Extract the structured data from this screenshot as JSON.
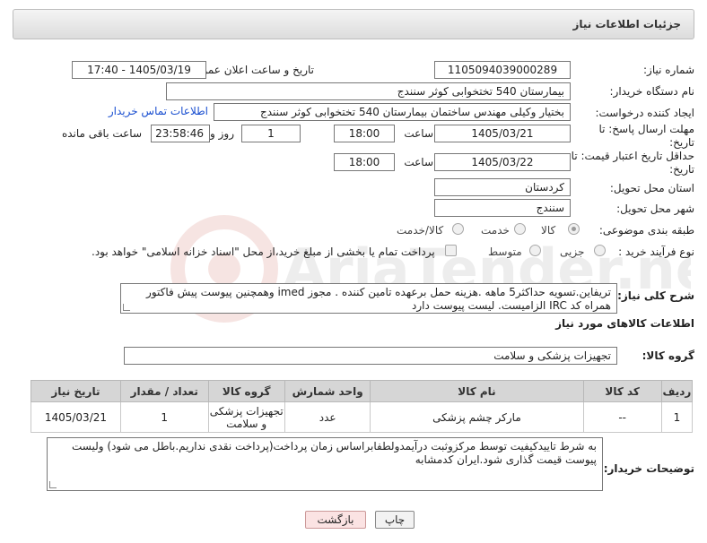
{
  "header": {
    "title": "جزئیات اطلاعات نیاز"
  },
  "fields": {
    "need_number_label": "شماره نیاز:",
    "need_number": "1105094039000289",
    "announce_label": "تاریخ و ساعت اعلان عمومی:",
    "announce_value": "1405/03/19 - 17:40",
    "buyer_org_label": "نام دستگاه خریدار:",
    "buyer_org": "بیمارستان 540 تختخوابی کوثر سنندج",
    "creator_label": "ایجاد کننده درخواست:",
    "creator": "بختیار وکیلی مهندس ساختمان بیمارستان 540 تختخوابی کوثر سنندج",
    "contact_link": "اطلاعات تماس خریدار",
    "deadline_label": "مهلت ارسال پاسخ: تا تاریخ:",
    "deadline_date": "1405/03/21",
    "time_label": "ساعت",
    "deadline_time": "18:00",
    "days_value": "1",
    "days_label": "روز و",
    "remaining_time": "23:58:46",
    "remaining_label": "ساعت باقی مانده",
    "validity_label": "حداقل تاریخ اعتبار قیمت: تا تاریخ:",
    "validity_date": "1405/03/22",
    "validity_time": "18:00",
    "province_label": "استان محل تحویل:",
    "province": "کردستان",
    "city_label": "شهر محل تحویل:",
    "city": "سنندج",
    "category_label": "طبقه بندی موضوعی:",
    "category_options": [
      "کالا",
      "خدمت",
      "کالا/خدمت"
    ],
    "process_label": "نوع فرآیند خرید :",
    "process_options": [
      "جزیی",
      "متوسط"
    ],
    "treasury_text": "پرداخت تمام یا بخشی از مبلغ خرید،از محل \"اسناد خزانه اسلامی\" خواهد بود."
  },
  "description": {
    "label": "شرح کلی نیاز:",
    "text": "تریفاین.تسویه حداکثر5 ماهه .هزینه حمل برعهده تامین کننده . مجوز imed وهمچنین پیوست پیش فاکتور همراه کد IRC  الزامیست. لیست پیوست دارد"
  },
  "goods": {
    "section_title": "اطلاعات کالاهای مورد نیاز",
    "group_label": "گروه کالا:",
    "group_value": "تجهیزات پزشکی و سلامت",
    "columns": [
      "ردیف",
      "کد کالا",
      "نام کالا",
      "واحد شمارش",
      "گروه کالا",
      "تعداد / مقدار",
      "تاریخ نیاز"
    ],
    "rows": [
      [
        "1",
        "--",
        "مارکر چشم پزشکی",
        "عدد",
        "تجهیزات پزشکی و سلامت",
        "1",
        "1405/03/21"
      ]
    ]
  },
  "buyer_notes": {
    "label": "توضیحات خریدار:",
    "text": "به شرط تاییدکیفیت توسط مرکزوثبت درآیمدولطفابراساس زمان پرداخت(پرداخت نقدی نداریم.باطل می شود) ولیست پیوست قیمت گذاری شود.ایران کدمشابه"
  },
  "buttons": {
    "print": "چاپ",
    "back": "بازگشت"
  },
  "watermark": {
    "text": "AriaTender.neT"
  }
}
